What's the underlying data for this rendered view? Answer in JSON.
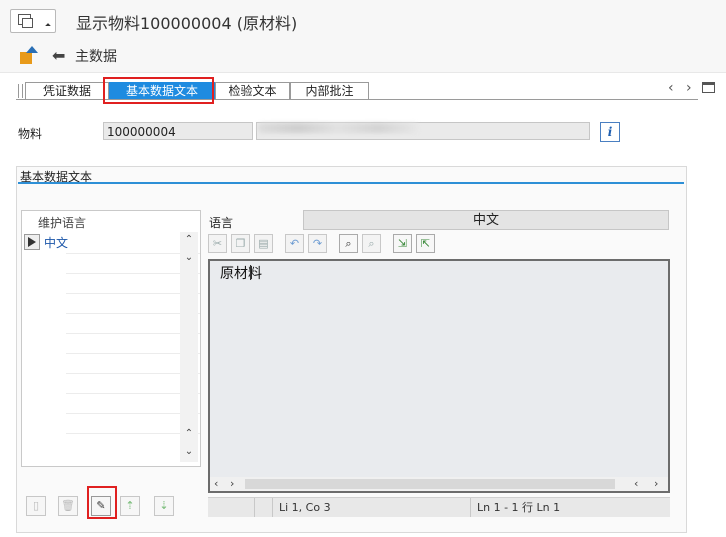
{
  "window": {
    "title": "显示物料100000004 (原材料)"
  },
  "toolbar": {
    "back_label": "主数据"
  },
  "tabs": [
    {
      "label": "凭证数据"
    },
    {
      "label": "基本数据文本"
    },
    {
      "label": "检验文本"
    },
    {
      "label": "内部批注"
    }
  ],
  "material": {
    "label": "物料",
    "value": "100000004",
    "description": ""
  },
  "group": {
    "title": "基本数据文本",
    "lang_list_header": "维护语言",
    "lang_list_items": [
      "中文"
    ],
    "language_label": "语言",
    "language_value": "中文",
    "editor_text": "原材料",
    "status": {
      "cursor": "Li 1, Co 3",
      "lines": "Ln 1 - 1 行 Ln 1"
    }
  },
  "icons": {
    "info": "i",
    "nav_prev": "‹",
    "nav_next": "›"
  },
  "colors": {
    "active_tab": "#1e8be0",
    "section_line": "#2d8fd6",
    "highlight": "#e02020"
  }
}
